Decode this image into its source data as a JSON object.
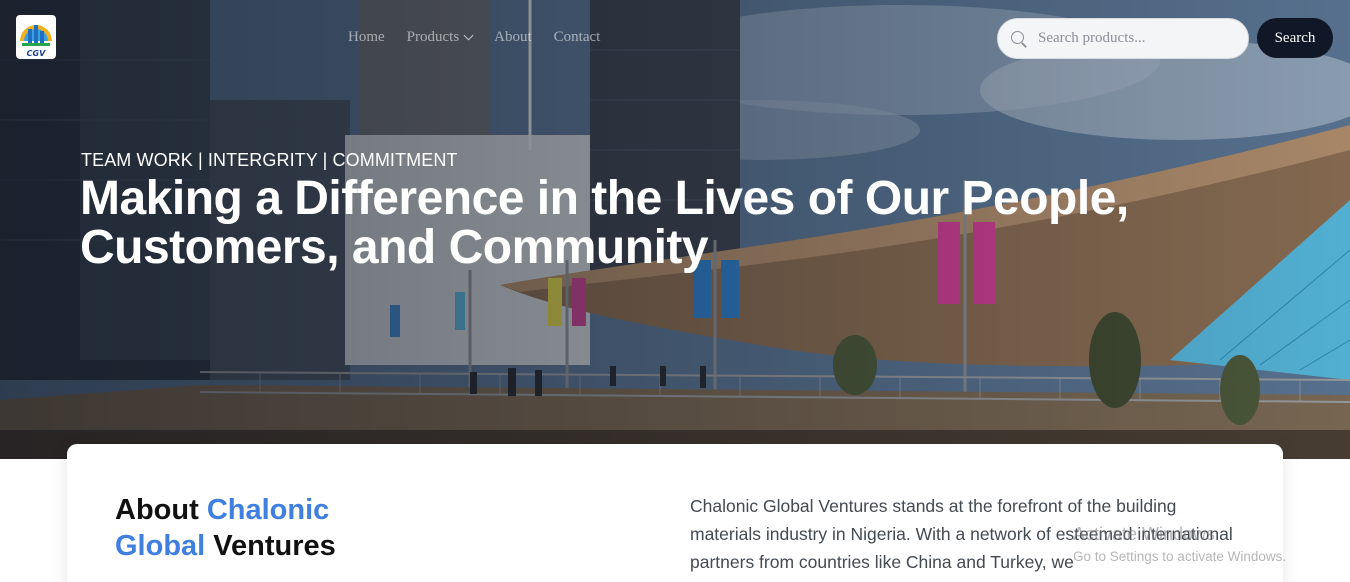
{
  "header": {
    "logo_text": "CGV",
    "nav": [
      {
        "label": "Home"
      },
      {
        "label": "Products",
        "has_dropdown": true
      },
      {
        "label": "About"
      },
      {
        "label": "Contact"
      }
    ],
    "search": {
      "placeholder": "Search products...",
      "value": ""
    },
    "search_button": "Search"
  },
  "hero": {
    "tagline": "TEAM WORK | INTERGRITY | COMMITMENT",
    "headline_line1": "Making a Difference in the Lives of Our People,",
    "headline_line2": "Customers, and Community"
  },
  "about": {
    "title_part1": "About ",
    "title_accent1": "Chalonic",
    "title_accent2": "Global",
    "title_part2": " Ventures",
    "text": "Chalonic Global Ventures stands at the forefront of the building materials industry in Nigeria. With a network of esteemed international partners from countries like China and Turkey, we"
  },
  "watermark": {
    "title": "Activate Windows",
    "subtitle": "Go to Settings to activate Windows."
  },
  "colors": {
    "accent": "#3f7fe0",
    "button_dark": "#101726"
  }
}
